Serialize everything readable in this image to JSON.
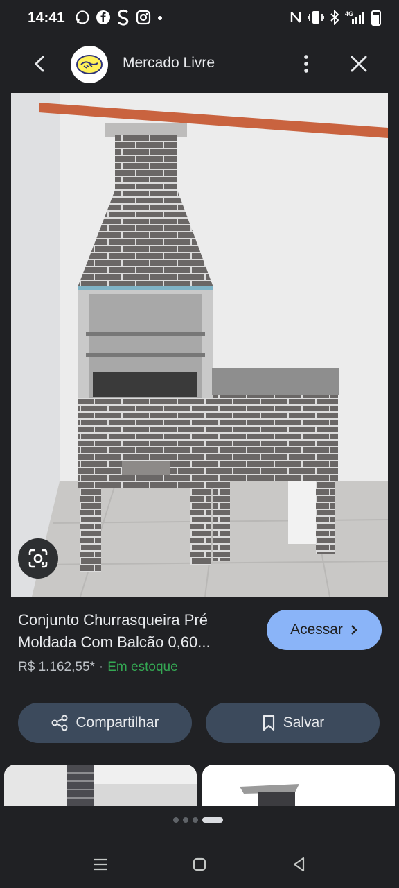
{
  "status_bar": {
    "time": "14:41",
    "left_icons": [
      "whatsapp-icon",
      "facebook-icon",
      "s-app-icon",
      "instagram-icon",
      "notification-dot"
    ],
    "right_icons": [
      "nfc-icon",
      "vibrate-icon",
      "bluetooth-icon",
      "4g-signal-icon",
      "battery-icon"
    ],
    "network": "4G"
  },
  "app_bar": {
    "title": "Mercado Livre",
    "back_icon": "chevron-left-icon",
    "menu_icon": "more-vert-icon",
    "close_icon": "close-icon"
  },
  "product": {
    "title": "Conjunto Churrasqueira Pré Moldada Com Balcão 0,60...",
    "price": "R$ 1.162,55*",
    "separator": "·",
    "availability": "Em estoque",
    "cta_label": "Acessar"
  },
  "actions": {
    "share_label": "Compartilhar",
    "save_label": "Salvar"
  },
  "colors": {
    "background": "#202124",
    "accent_button": "#8ab4f8",
    "pill_button": "#3c4a5c",
    "in_stock": "#34a853"
  },
  "carousel": {
    "pages": 4,
    "active_page": 4
  },
  "navigation": {
    "buttons": [
      "recents-icon",
      "home-icon",
      "back-triangle-icon"
    ]
  }
}
